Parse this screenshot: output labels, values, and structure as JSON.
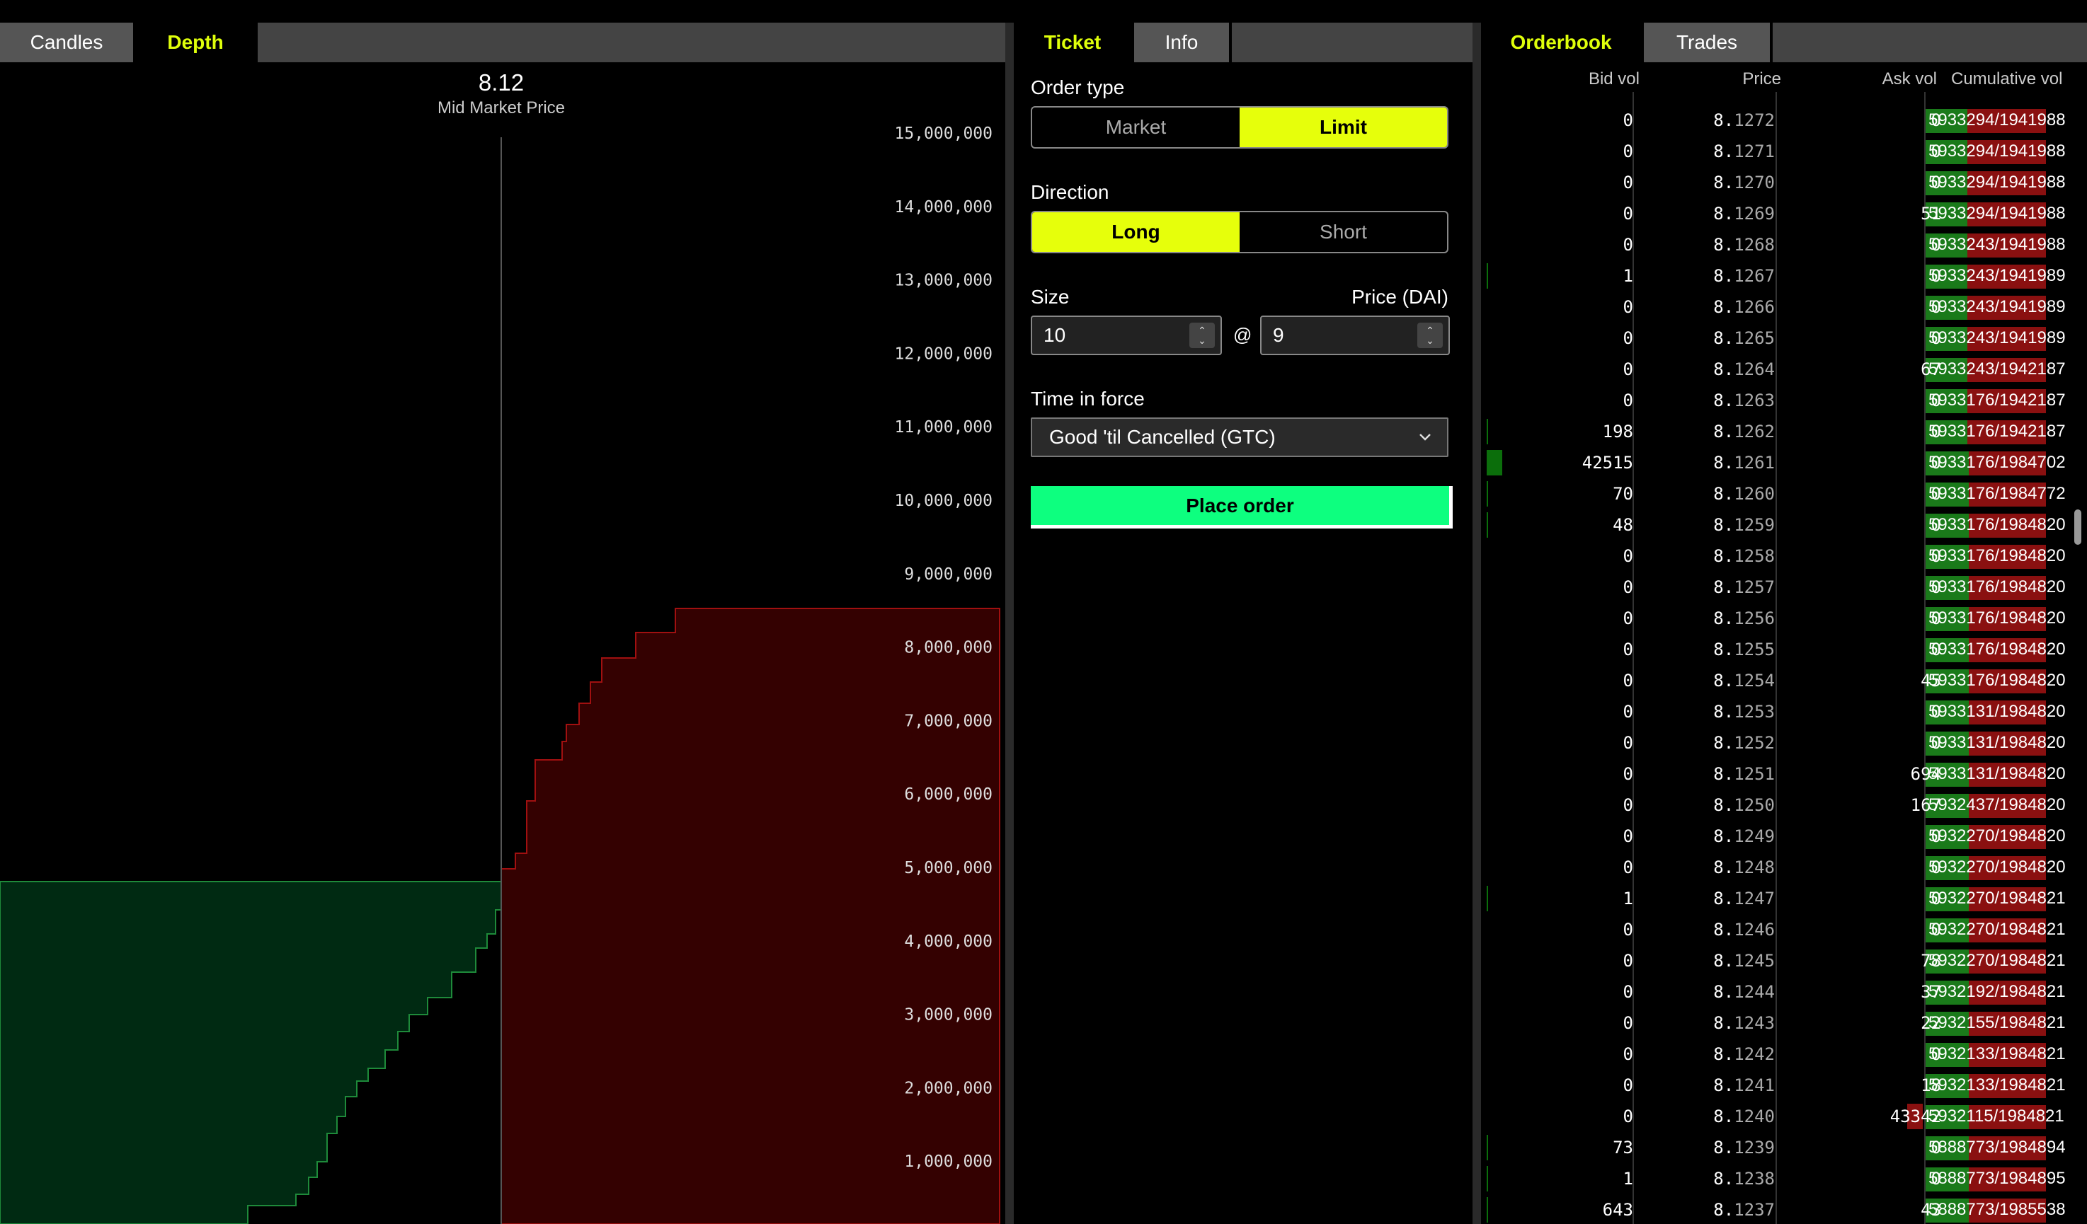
{
  "depth_tabs": [
    {
      "label": "Candles",
      "active": false
    },
    {
      "label": "Depth",
      "active": true
    }
  ],
  "depth": {
    "mid_price": "8.12",
    "mid_caption": "Mid Market Price",
    "y_ticks": [
      "15,000,000",
      "14,000,000",
      "13,000,000",
      "12,000,000",
      "11,000,000",
      "10,000,000",
      "9,000,000",
      "8,000,000",
      "7,000,000",
      "6,000,000",
      "5,000,000",
      "4,000,000",
      "3,000,000",
      "2,000,000",
      "1,000,000"
    ],
    "colors": {
      "bid_fill": "#002a12",
      "bid_stroke": "#1e8a3a",
      "ask_fill": "#340101",
      "ask_stroke": "#a01010"
    }
  },
  "ticket_tabs": [
    {
      "label": "Ticket",
      "active": true
    },
    {
      "label": "Info",
      "active": false
    }
  ],
  "ticket": {
    "order_type_label": "Order type",
    "order_types": [
      {
        "label": "Market",
        "selected": false
      },
      {
        "label": "Limit",
        "selected": true
      }
    ],
    "direction_label": "Direction",
    "directions": [
      {
        "label": "Long",
        "selected": true
      },
      {
        "label": "Short",
        "selected": false
      }
    ],
    "size_label": "Size",
    "price_label": "Price (DAI)",
    "size_value": "10",
    "at_symbol": "@",
    "price_value": "9",
    "tif_label": "Time in force",
    "tif_value": "Good 'til Cancelled (GTC)",
    "place_order": "Place order"
  },
  "ob_tabs": [
    {
      "label": "Orderbook",
      "active": true
    },
    {
      "label": "Trades",
      "active": false
    }
  ],
  "orderbook": {
    "headers": {
      "bid": "Bid vol",
      "price": "Price",
      "ask": "Ask vol",
      "cum": "Cumulative vol"
    },
    "rows": [
      {
        "bid": "0",
        "price_int": "8.",
        "price_frac": "1272",
        "ask": "0",
        "cum": "5933294/1941988",
        "bidbar": 0,
        "askbar": 0,
        "cumg": 0.28
      },
      {
        "bid": "0",
        "price_int": "8.",
        "price_frac": "1271",
        "ask": "0",
        "cum": "5933294/1941988",
        "bidbar": 0,
        "askbar": 0,
        "cumg": 0.28
      },
      {
        "bid": "0",
        "price_int": "8.",
        "price_frac": "1270",
        "ask": "0",
        "cum": "5933294/1941988",
        "bidbar": 0,
        "askbar": 0,
        "cumg": 0.28
      },
      {
        "bid": "0",
        "price_int": "8.",
        "price_frac": "1269",
        "ask": "51",
        "cum": "5933294/1941988",
        "bidbar": 0,
        "askbar": 0,
        "cumg": 0.28
      },
      {
        "bid": "0",
        "price_int": "8.",
        "price_frac": "1268",
        "ask": "0",
        "cum": "5933243/1941988",
        "bidbar": 0,
        "askbar": 0,
        "cumg": 0.28
      },
      {
        "bid": "1",
        "price_int": "8.",
        "price_frac": "1267",
        "ask": "0",
        "cum": "5933243/1941989",
        "bidbar": 2,
        "askbar": 0,
        "cumg": 0.28
      },
      {
        "bid": "0",
        "price_int": "8.",
        "price_frac": "1266",
        "ask": "0",
        "cum": "5933243/1941989",
        "bidbar": 0,
        "askbar": 0,
        "cumg": 0.28
      },
      {
        "bid": "0",
        "price_int": "8.",
        "price_frac": "1265",
        "ask": "0",
        "cum": "5933243/1941989",
        "bidbar": 0,
        "askbar": 0,
        "cumg": 0.28
      },
      {
        "bid": "0",
        "price_int": "8.",
        "price_frac": "1264",
        "ask": "67",
        "cum": "5933243/1942187",
        "bidbar": 0,
        "askbar": 0,
        "cumg": 0.28
      },
      {
        "bid": "0",
        "price_int": "8.",
        "price_frac": "1263",
        "ask": "0",
        "cum": "5933176/1942187",
        "bidbar": 0,
        "askbar": 0,
        "cumg": 0.28
      },
      {
        "bid": "198",
        "price_int": "8.",
        "price_frac": "1262",
        "ask": "0",
        "cum": "5933176/1942187",
        "bidbar": 2,
        "askbar": 0,
        "cumg": 0.28
      },
      {
        "bid": "42515",
        "price_int": "8.",
        "price_frac": "1261",
        "ask": "0",
        "cum": "5933176/1984702",
        "bidbar": 22,
        "askbar": 0,
        "cumg": 0.29
      },
      {
        "bid": "70",
        "price_int": "8.",
        "price_frac": "1260",
        "ask": "0",
        "cum": "5933176/1984772",
        "bidbar": 2,
        "askbar": 0,
        "cumg": 0.29
      },
      {
        "bid": "48",
        "price_int": "8.",
        "price_frac": "1259",
        "ask": "0",
        "cum": "5933176/1984820",
        "bidbar": 2,
        "askbar": 0,
        "cumg": 0.29
      },
      {
        "bid": "0",
        "price_int": "8.",
        "price_frac": "1258",
        "ask": "0",
        "cum": "5933176/1984820",
        "bidbar": 0,
        "askbar": 0,
        "cumg": 0.29
      },
      {
        "bid": "0",
        "price_int": "8.",
        "price_frac": "1257",
        "ask": "0",
        "cum": "5933176/1984820",
        "bidbar": 0,
        "askbar": 0,
        "cumg": 0.29
      },
      {
        "bid": "0",
        "price_int": "8.",
        "price_frac": "1256",
        "ask": "0",
        "cum": "5933176/1984820",
        "bidbar": 0,
        "askbar": 0,
        "cumg": 0.29
      },
      {
        "bid": "0",
        "price_int": "8.",
        "price_frac": "1255",
        "ask": "0",
        "cum": "5933176/1984820",
        "bidbar": 0,
        "askbar": 0,
        "cumg": 0.29
      },
      {
        "bid": "0",
        "price_int": "8.",
        "price_frac": "1254",
        "ask": "45",
        "cum": "5933176/1984820",
        "bidbar": 0,
        "askbar": 0,
        "cumg": 0.29
      },
      {
        "bid": "0",
        "price_int": "8.",
        "price_frac": "1253",
        "ask": "0",
        "cum": "5933131/1984820",
        "bidbar": 0,
        "askbar": 0,
        "cumg": 0.29
      },
      {
        "bid": "0",
        "price_int": "8.",
        "price_frac": "1252",
        "ask": "0",
        "cum": "5933131/1984820",
        "bidbar": 0,
        "askbar": 0,
        "cumg": 0.29
      },
      {
        "bid": "0",
        "price_int": "8.",
        "price_frac": "1251",
        "ask": "694",
        "cum": "5933131/1984820",
        "bidbar": 0,
        "askbar": 0,
        "cumg": 0.29
      },
      {
        "bid": "0",
        "price_int": "8.",
        "price_frac": "1250",
        "ask": "167",
        "cum": "5932437/1984820",
        "bidbar": 0,
        "askbar": 0,
        "cumg": 0.29
      },
      {
        "bid": "0",
        "price_int": "8.",
        "price_frac": "1249",
        "ask": "0",
        "cum": "5932270/1984820",
        "bidbar": 0,
        "askbar": 0,
        "cumg": 0.29
      },
      {
        "bid": "0",
        "price_int": "8.",
        "price_frac": "1248",
        "ask": "0",
        "cum": "5932270/1984820",
        "bidbar": 0,
        "askbar": 0,
        "cumg": 0.29
      },
      {
        "bid": "1",
        "price_int": "8.",
        "price_frac": "1247",
        "ask": "0",
        "cum": "5932270/1984821",
        "bidbar": 2,
        "askbar": 0,
        "cumg": 0.29
      },
      {
        "bid": "0",
        "price_int": "8.",
        "price_frac": "1246",
        "ask": "0",
        "cum": "5932270/1984821",
        "bidbar": 0,
        "askbar": 0,
        "cumg": 0.29
      },
      {
        "bid": "0",
        "price_int": "8.",
        "price_frac": "1245",
        "ask": "78",
        "cum": "5932270/1984821",
        "bidbar": 0,
        "askbar": 0,
        "cumg": 0.29
      },
      {
        "bid": "0",
        "price_int": "8.",
        "price_frac": "1244",
        "ask": "37",
        "cum": "5932192/1984821",
        "bidbar": 0,
        "askbar": 0,
        "cumg": 0.29
      },
      {
        "bid": "0",
        "price_int": "8.",
        "price_frac": "1243",
        "ask": "22",
        "cum": "5932155/1984821",
        "bidbar": 0,
        "askbar": 0,
        "cumg": 0.29
      },
      {
        "bid": "0",
        "price_int": "8.",
        "price_frac": "1242",
        "ask": "0",
        "cum": "5932133/1984821",
        "bidbar": 0,
        "askbar": 0,
        "cumg": 0.29
      },
      {
        "bid": "0",
        "price_int": "8.",
        "price_frac": "1241",
        "ask": "18",
        "cum": "5932133/1984821",
        "bidbar": 0,
        "askbar": 0,
        "cumg": 0.29
      },
      {
        "bid": "0",
        "price_int": "8.",
        "price_frac": "1240",
        "ask": "43342",
        "cum": "5932115/1984821",
        "bidbar": 0,
        "askbar": 22,
        "cumg": 0.29
      },
      {
        "bid": "73",
        "price_int": "8.",
        "price_frac": "1239",
        "ask": "0",
        "cum": "5888773/1984894",
        "bidbar": 2,
        "askbar": 0,
        "cumg": 0.29
      },
      {
        "bid": "1",
        "price_int": "8.",
        "price_frac": "1238",
        "ask": "0",
        "cum": "5888773/1984895",
        "bidbar": 2,
        "askbar": 0,
        "cumg": 0.29
      },
      {
        "bid": "643",
        "price_int": "8.",
        "price_frac": "1237",
        "ask": "43",
        "cum": "5888773/1985538",
        "bidbar": 2,
        "askbar": 0,
        "cumg": 0.29
      }
    ]
  }
}
